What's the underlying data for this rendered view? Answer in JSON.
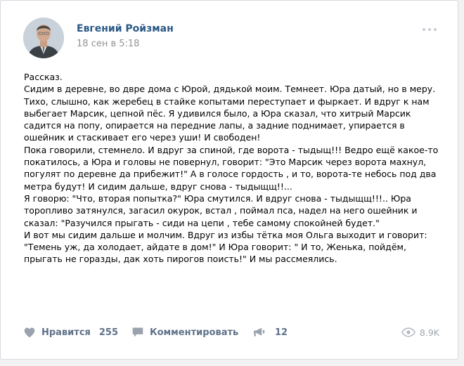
{
  "post": {
    "author": "Евгений Ройзман",
    "date": "18 сен в 5:18",
    "text": "Рассказ.\nСидим в деревне, во двре дома с Юрой, дядькой моим. Темнеет. Юра датый, но в меру. Тихо, слышно, как жеребец в стайке копытами переступает и фыркает. И вдруг к нам выбегает Марсик, цепной пёс. Я удивился было, а Юра сказал, что хитрый Марсик садится на попу, опирается на передние лапы, а задние поднимает, упирается в ошейник и стаскивает его через уши! И свободен!\nПока говорили, стемнело. И вдруг за спиной, где ворота - тыдыщ!!! Ведро ещё какое-то покатилось, а Юра и головы не повернул, говорит: \"Это Марсик через ворота махнул, погулят по деревне да прибежит!\" А в голосе гордость , и то, ворота-те небось под два метра будут! И сидим дальше, вдруг снова - тыдыщщ!!...\nЯ говорю: \"Что, вторая попытка?\" Юра смутился. И вдруг снова - тыдыщщ!!!.. Юра торопливо затянулся, загасил окурок, встал , поймал пса, надел на него ошейник и сказал: \"Разучился прыгать - сиди на цепи , тебе самому спокойней будет.\"\nИ вот мы сидим дальше и молчим. Вдруг из избы тётка моя Ольга выходит и говорит: \"Темень уж, да холодает, айдате в дом!\" И Юра говорит: \" И то, Женька, пойдём, прыгать не горазды, дак хоть пирогов поисть!\" И мы рассмеялись."
  },
  "footer": {
    "like_label": "Нравится",
    "like_count": "255",
    "comment_label": "Комментировать",
    "repost_count": "12",
    "views": "8.9K"
  },
  "icons": {
    "like": "heart-icon",
    "comment": "comment-icon",
    "repost": "megaphone-icon",
    "views": "eye-icon",
    "more": "more-dots-icon"
  },
  "colors": {
    "link": "#2a5885",
    "muted": "#939393",
    "action": "#5e7189"
  }
}
